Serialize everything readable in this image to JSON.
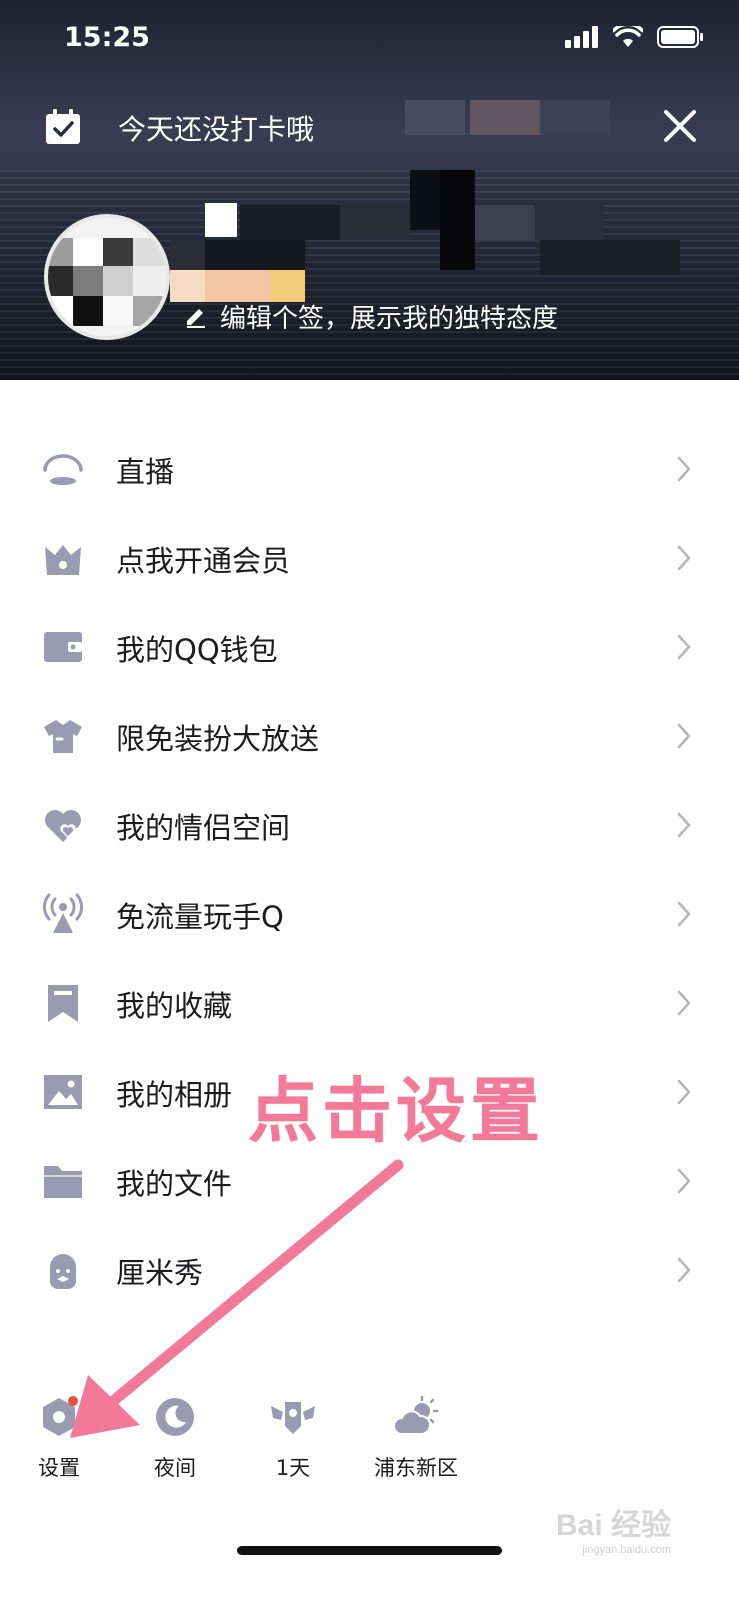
{
  "status": {
    "time": "15:25"
  },
  "header": {
    "checkin_text": "今天还没打卡哦",
    "signature_placeholder": "编辑个签，展示我的独特态度"
  },
  "menu": {
    "items": [
      {
        "label": "直播",
        "icon": "live-icon"
      },
      {
        "label": "点我开通会员",
        "icon": "vip-crown-icon"
      },
      {
        "label": "我的QQ钱包",
        "icon": "wallet-icon"
      },
      {
        "label": "限免装扮大放送",
        "icon": "tshirt-icon"
      },
      {
        "label": "我的情侣空间",
        "icon": "heart-icon"
      },
      {
        "label": "免流量玩手Q",
        "icon": "antenna-icon"
      },
      {
        "label": "我的收藏",
        "icon": "bookmark-icon"
      },
      {
        "label": "我的相册",
        "icon": "photo-icon"
      },
      {
        "label": "我的文件",
        "icon": "folder-icon"
      },
      {
        "label": "厘米秀",
        "icon": "cmshow-icon"
      }
    ]
  },
  "annotation": {
    "text": "点击设置"
  },
  "bottom": {
    "settings": "设置",
    "night": "夜间",
    "days": "1天",
    "weather": "浦东新区"
  },
  "watermark": {
    "brand": "Bai 经验",
    "url": "jingyan.baidu.com"
  },
  "colors": {
    "icon": "#9a9bb1",
    "annotation": "#f27a98",
    "text": "#1c1c1e"
  }
}
